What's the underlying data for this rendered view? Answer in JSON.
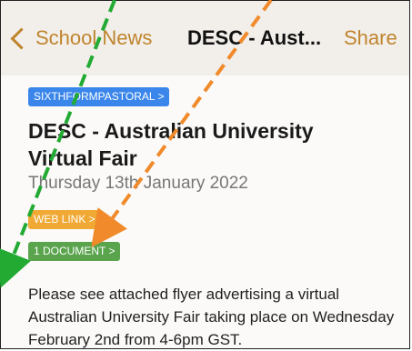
{
  "navbar": {
    "back_label": "School News",
    "title": "DESC - Aust...",
    "share_label": "Share"
  },
  "post": {
    "category": "SIXTHFORMPASTORAL >",
    "title": "DESC - Australian University Virtual Fair",
    "date": "Thursday 13th January 2022",
    "web_link": "WEB LINK >",
    "documents": "1 DOCUMENT >",
    "body": "Please see attached flyer advertising a virtual Australian University Fair taking place on Wednesday February 2nd from 4-6pm GST."
  },
  "colors": {
    "accent": "#c0842d",
    "category_badge": "#3b86ea",
    "web_link_badge": "#f0a934",
    "documents_badge": "#5aa44d",
    "green_arrow": "#22aa33",
    "orange_arrow": "#f08a2a"
  }
}
